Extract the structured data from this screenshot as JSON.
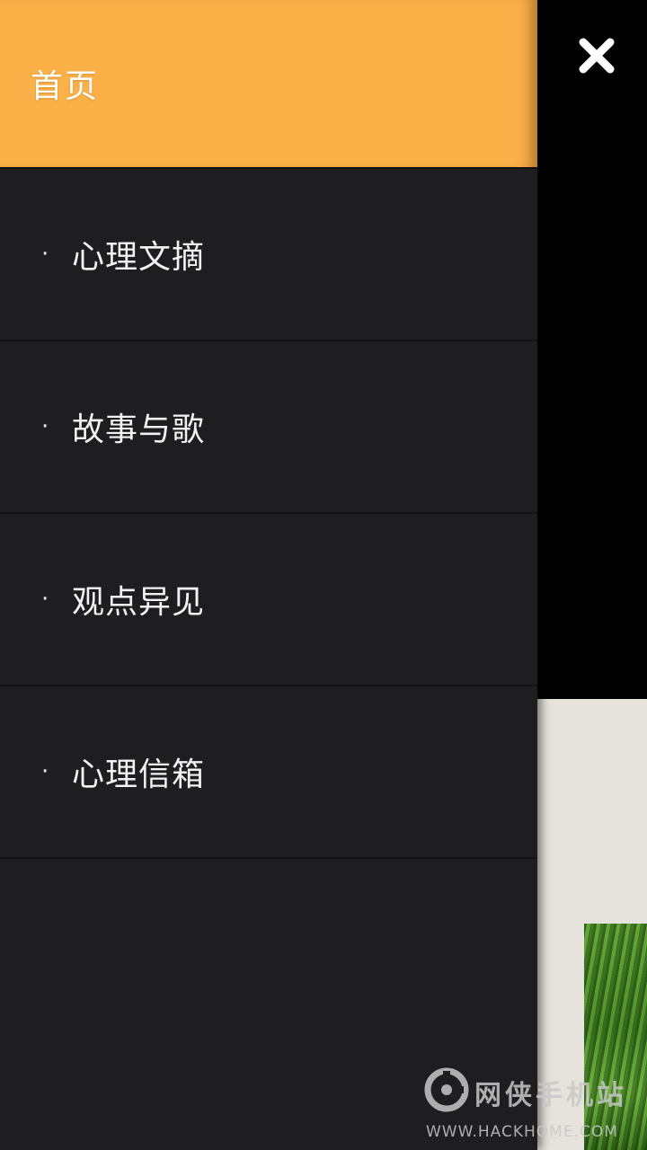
{
  "drawer": {
    "header_label": "首页",
    "items": [
      {
        "bullet": "·",
        "label": "心理文摘"
      },
      {
        "bullet": "·",
        "label": "故事与歌"
      },
      {
        "bullet": "·",
        "label": "观点异见"
      },
      {
        "bullet": "·",
        "label": "心理信箱"
      }
    ]
  },
  "close_icon": "close-icon",
  "watermark": {
    "title": "网侠手机站",
    "url": "WWW.HACKHOME.COM"
  },
  "colors": {
    "header_bg": "#fbb048",
    "drawer_bg": "#1e1e20",
    "page_bg": "#000000",
    "content_bg": "#e6e2dc"
  }
}
